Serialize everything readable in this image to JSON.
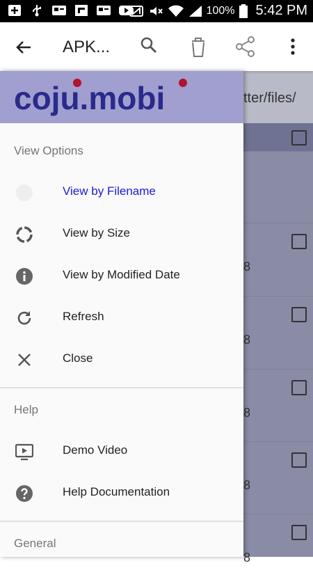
{
  "status_bar": {
    "battery": "100%",
    "time": "5:42 PM"
  },
  "app_bar": {
    "title": "APK..."
  },
  "background": {
    "path_fragment": "tter/files/",
    "row_values": [
      "8",
      "8",
      "8",
      "8",
      "8"
    ]
  },
  "drawer": {
    "logo_text": "coju.mobi",
    "sections": {
      "view_options": "View Options",
      "help": "Help",
      "general": "General"
    },
    "view_items": [
      {
        "label": "View by Filename",
        "icon": "info-icon",
        "active": true
      },
      {
        "label": "View by Size",
        "icon": "donut-icon"
      },
      {
        "label": "View by Modified Date",
        "icon": "info-icon"
      },
      {
        "label": "Refresh",
        "icon": "refresh-icon"
      },
      {
        "label": "Close",
        "icon": "close-icon"
      }
    ],
    "help_items": [
      {
        "label": "Demo Video",
        "icon": "play-screen-icon"
      },
      {
        "label": "Help Documentation",
        "icon": "help-icon"
      }
    ]
  },
  "colors": {
    "active_text": "#1a1ad6",
    "logo_bg": "#a09fcf",
    "logo_text": "#2a2a8c",
    "logo_dot": "#b0132b"
  }
}
